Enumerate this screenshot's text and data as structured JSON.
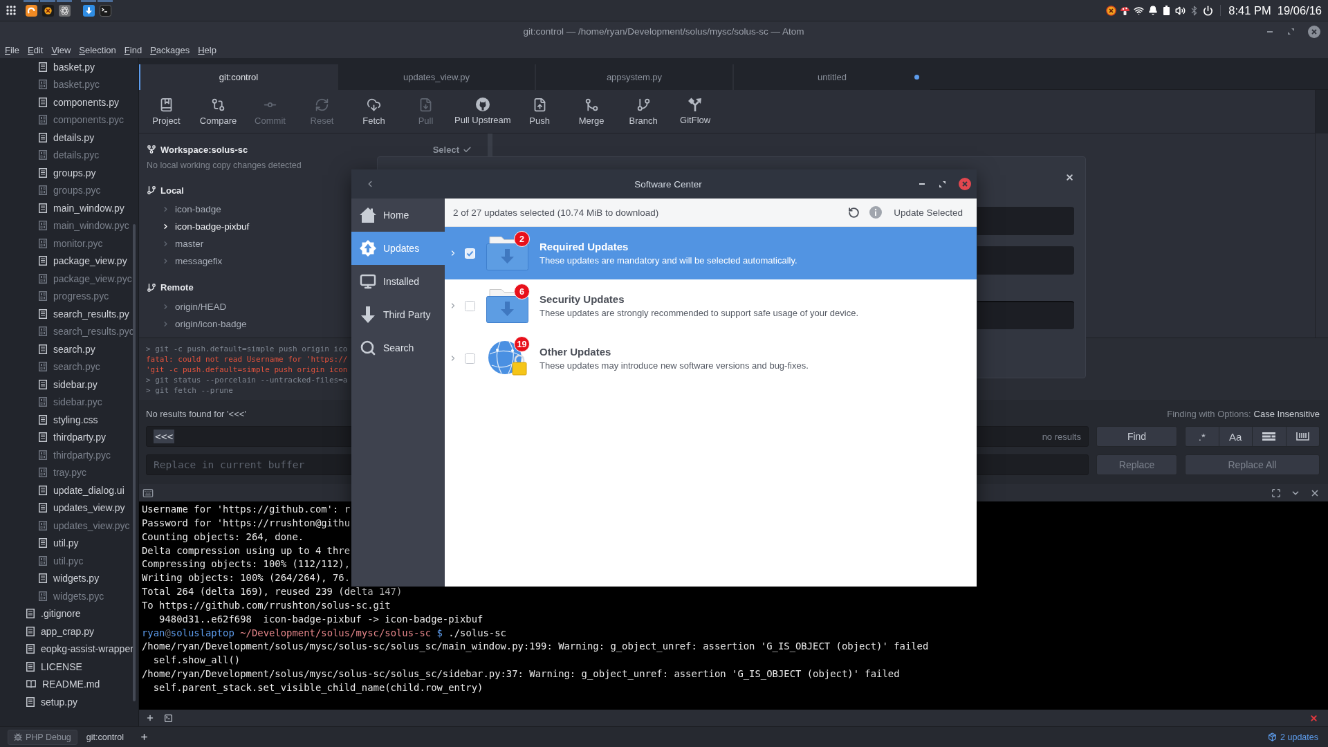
{
  "top_panel": {
    "time": "8:41 PM",
    "date": "19/06/16"
  },
  "window": {
    "title": "git:control — /home/ryan/Development/solus/mysc/solus-sc — Atom"
  },
  "menu": [
    "File",
    "Edit",
    "View",
    "Selection",
    "Find",
    "Packages",
    "Help"
  ],
  "tree_view": [
    {
      "children": [
        {
          "label": "basket.py",
          "kind": "text"
        },
        {
          "label": "basket.pyc",
          "kind": "binary"
        },
        {
          "label": "components.py",
          "kind": "text"
        },
        {
          "label": "components.pyc",
          "kind": "binary"
        },
        {
          "label": "details.py",
          "kind": "text"
        },
        {
          "label": "details.pyc",
          "kind": "binary"
        },
        {
          "label": "groups.py",
          "kind": "text"
        },
        {
          "label": "groups.pyc",
          "kind": "binary"
        },
        {
          "label": "main_window.py",
          "kind": "text"
        },
        {
          "label": "main_window.pyc",
          "kind": "binary"
        },
        {
          "label": "monitor.pyc",
          "kind": "binary"
        },
        {
          "label": "package_view.py",
          "kind": "text"
        },
        {
          "label": "package_view.pyc",
          "kind": "binary"
        },
        {
          "label": "progress.pyc",
          "kind": "binary"
        },
        {
          "label": "search_results.py",
          "kind": "text"
        },
        {
          "label": "search_results.pyc",
          "kind": "binary"
        },
        {
          "label": "search.py",
          "kind": "text"
        },
        {
          "label": "search.pyc",
          "kind": "binary"
        },
        {
          "label": "sidebar.py",
          "kind": "text"
        },
        {
          "label": "sidebar.pyc",
          "kind": "binary"
        },
        {
          "label": "styling.css",
          "kind": "text"
        },
        {
          "label": "thirdparty.py",
          "kind": "text"
        },
        {
          "label": "thirdparty.pyc",
          "kind": "binary"
        },
        {
          "label": "tray.pyc",
          "kind": "binary"
        },
        {
          "label": "update_dialog.ui",
          "kind": "text"
        },
        {
          "label": "updates_view.py",
          "kind": "text"
        },
        {
          "label": "updates_view.pyc",
          "kind": "binary"
        },
        {
          "label": "util.py",
          "kind": "text"
        },
        {
          "label": "util.pyc",
          "kind": "binary"
        },
        {
          "label": "widgets.py",
          "kind": "text"
        },
        {
          "label": "widgets.pyc",
          "kind": "binary"
        }
      ]
    },
    {
      "label": ".gitignore",
      "kind": "text"
    },
    {
      "label": "app_crap.py",
      "kind": "text"
    },
    {
      "label": "eopkg-assist-wrapper",
      "kind": "text"
    },
    {
      "label": "LICENSE",
      "kind": "text"
    },
    {
      "label": "README.md",
      "kind": "book"
    },
    {
      "label": "setup.py",
      "kind": "text"
    }
  ],
  "tabs": [
    {
      "label": "git:control",
      "selected": true,
      "modified": false
    },
    {
      "label": "updates_view.py",
      "selected": false,
      "modified": false
    },
    {
      "label": "appsystem.py",
      "selected": false,
      "modified": false
    },
    {
      "label": "untitled",
      "selected": false,
      "modified": true
    }
  ],
  "git_toolbar": [
    {
      "label": "Project",
      "disabled": false
    },
    {
      "label": "Compare",
      "disabled": false
    },
    {
      "label": "Commit",
      "disabled": true
    },
    {
      "label": "Reset",
      "disabled": true
    },
    {
      "label": "Fetch",
      "disabled": false
    },
    {
      "label": "Pull",
      "disabled": true
    },
    {
      "label": "Pull Upstream",
      "disabled": false
    },
    {
      "label": "Push",
      "disabled": false
    },
    {
      "label": "Merge",
      "disabled": false
    },
    {
      "label": "Branch",
      "disabled": false
    },
    {
      "label": "GitFlow",
      "disabled": false
    }
  ],
  "git_panel": {
    "workspace": "Workspace:solus-sc",
    "select_button": "Select",
    "status": "No local working copy changes detected",
    "sections": [
      {
        "title": "Local",
        "branches": [
          {
            "label": "icon-badge",
            "selected": false
          },
          {
            "label": "icon-badge-pixbuf",
            "selected": true
          },
          {
            "label": "master",
            "selected": false
          },
          {
            "label": "messagefix",
            "selected": false
          }
        ]
      },
      {
        "title": "Remote",
        "branches": [
          {
            "label": "origin/HEAD",
            "selected": false
          },
          {
            "label": "origin/icon-badge",
            "selected": false
          }
        ]
      }
    ]
  },
  "git_log": [
    {
      "kind": "command",
      "text": "> git -c push.default=simple push origin ico"
    },
    {
      "kind": "error",
      "text": "fatal: could not read Username for 'https://"
    },
    {
      "kind": "error",
      "text": "'git -c push.default=simple push origin icon"
    },
    {
      "kind": "command",
      "text": "> git status --porcelain --untracked-files=a"
    },
    {
      "kind": "command",
      "text": "> git fetch --prune"
    }
  ],
  "software_center": {
    "title": "Software Center",
    "nav": [
      {
        "label": "Home",
        "selected": false
      },
      {
        "label": "Updates",
        "selected": true
      },
      {
        "label": "Installed",
        "selected": false
      },
      {
        "label": "Third Party",
        "selected": false
      },
      {
        "label": "Search",
        "selected": false
      }
    ],
    "summary": "2 of 27 updates selected (10.74 MiB to download)",
    "update_button": "Update Selected",
    "categories": [
      {
        "kind": "required",
        "title": "Required Updates",
        "description": "These updates are mandatory and will be selected automatically.",
        "count": "2",
        "selected": true,
        "checked": true
      },
      {
        "kind": "security",
        "title": "Security Updates",
        "description": "These updates are strongly recommended to support safe usage of your device.",
        "count": "6",
        "selected": false,
        "checked": false
      },
      {
        "kind": "other",
        "title": "Other Updates",
        "description": "These updates may introduce new software versions and bug-fixes.",
        "count": "19",
        "selected": false,
        "checked": false
      }
    ]
  },
  "find_panel": {
    "message": "No results found for '<<<'",
    "options_label": "Finding with Options:",
    "options_value": "Case Insensitive",
    "find_value": "<<<",
    "result_count": "no results",
    "replace_placeholder": "Replace in current buffer",
    "buttons": [
      {
        "label": "Find",
        "disabled": false
      },
      {
        "label": "Replace",
        "disabled": true
      },
      {
        "label": "Replace All",
        "disabled": true
      }
    ],
    "toggles": [
      {
        "kind": "text",
        "label": ".*",
        "selected": false
      },
      {
        "kind": "text",
        "label": "Aa",
        "selected": false
      },
      {
        "kind": "selection",
        "selected": false
      },
      {
        "kind": "whole_word",
        "selected": false
      }
    ]
  },
  "terminal": [
    {
      "kind": "output",
      "text": "Username for 'https://github.com': r"
    },
    {
      "kind": "output",
      "text": "Password for 'https://rrushton@githu"
    },
    {
      "kind": "output",
      "text": "Counting objects: 264, done."
    },
    {
      "kind": "output",
      "text": "Delta compression using up to 4 thre"
    },
    {
      "kind": "output",
      "text": "Compressing objects: 100% (112/112),"
    },
    {
      "kind": "output",
      "text": "Writing objects: 100% (264/264), 76."
    },
    {
      "kind": "output",
      "text": "Total 264 (delta 169), reused 239 (delta 147)"
    },
    {
      "kind": "output",
      "text": "To https://github.com/rrushton/solus-sc.git"
    },
    {
      "kind": "output",
      "text": "   9480d31..e62f698  icon-badge-pixbuf -> icon-badge-pixbuf"
    },
    {
      "kind": "prompt",
      "user": "ryan",
      "at": "@",
      "host": "soluslaptop",
      "path": "~/Development/solus/mysc/solus-sc",
      "symbol": "$",
      "command": "./solus-sc"
    },
    {
      "kind": "output",
      "text": "/home/ryan/Development/solus/mysc/solus-sc/solus_sc/main_window.py:199: Warning: g_object_unref: assertion 'G_IS_OBJECT (object)' failed"
    },
    {
      "kind": "output",
      "text": "  self.show_all()"
    },
    {
      "kind": "output",
      "text": "/home/ryan/Development/solus/mysc/solus-sc/solus_sc/sidebar.py:37: Warning: g_object_unref: assertion 'G_IS_OBJECT (object)' failed"
    },
    {
      "kind": "output",
      "text": "  self.parent_stack.set_visible_child_name(child.row_entry)"
    }
  ],
  "status_bar": {
    "debug_button": "PHP Debug",
    "terminal_tab": "git:control",
    "updates": "2 updates"
  }
}
